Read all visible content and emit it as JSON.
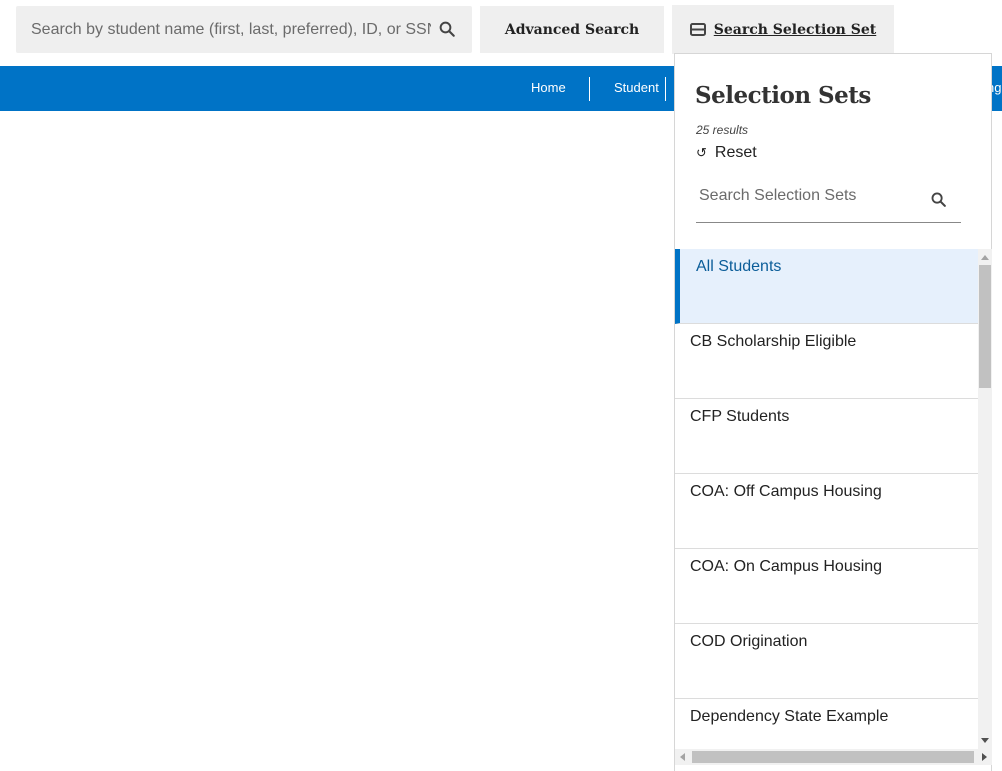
{
  "header": {
    "search_placeholder": "Search by student name (first, last, preferred), ID, or SSN",
    "search_icon": "search-icon",
    "advanced_search_label": "Advanced Search",
    "selection_set_label": "Search Selection Set",
    "selection_set_icon": "list-box-icon"
  },
  "nav": {
    "items": [
      {
        "label": "Home"
      },
      {
        "label": "Student"
      },
      {
        "label": "ng"
      }
    ],
    "bg_color": "#0073c6"
  },
  "popup": {
    "title": "Selection Sets",
    "results_text": "25 results",
    "reset_label": "Reset",
    "reset_icon": "↺",
    "search_placeholder": "Search Selection Sets",
    "items": [
      {
        "label": "All Students",
        "active": true
      },
      {
        "label": "CB Scholarship Eligible"
      },
      {
        "label": "CFP Students"
      },
      {
        "label": "COA: Off Campus Housing"
      },
      {
        "label": "COA: On Campus Housing"
      },
      {
        "label": "COD Origination"
      },
      {
        "label": "Dependency State Example"
      }
    ]
  }
}
